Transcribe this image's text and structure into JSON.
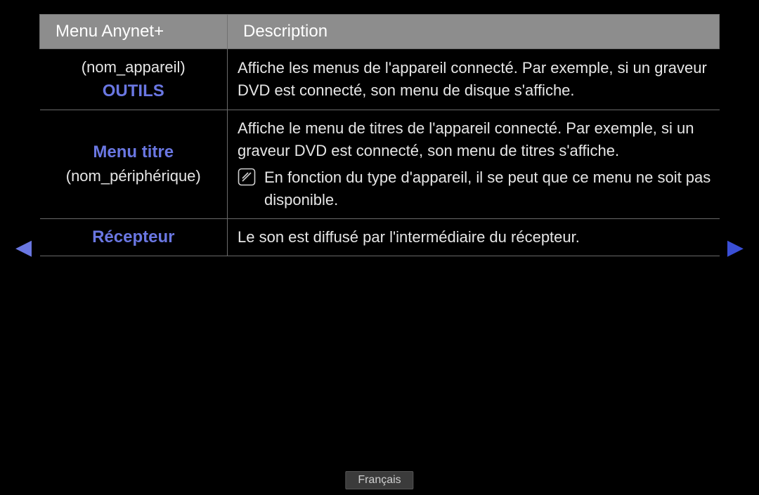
{
  "header": {
    "col_menu": "Menu Anynet+",
    "col_desc": "Description"
  },
  "rows": [
    {
      "menu_sub": "(nom_appareil)",
      "menu_label": "OUTILS",
      "desc": "Affiche les menus de l'appareil connecté. Par exemple, si un graveur DVD est connecté, son menu de disque s'affiche."
    },
    {
      "menu_label": "Menu titre",
      "menu_sub": "(nom_périphérique)",
      "desc": "Affiche le menu de titres de l'appareil connecté. Par exemple, si un graveur DVD est connecté, son menu de titres s'affiche.",
      "note": "En fonction du type d'appareil, il se peut que ce menu ne soit pas disponible."
    },
    {
      "menu_label": "Récepteur",
      "desc": "Le son est diffusé par l'intermédiaire du récepteur."
    }
  ],
  "nav": {
    "left": "◀",
    "right": "▶"
  },
  "footer": {
    "language": "Français"
  }
}
